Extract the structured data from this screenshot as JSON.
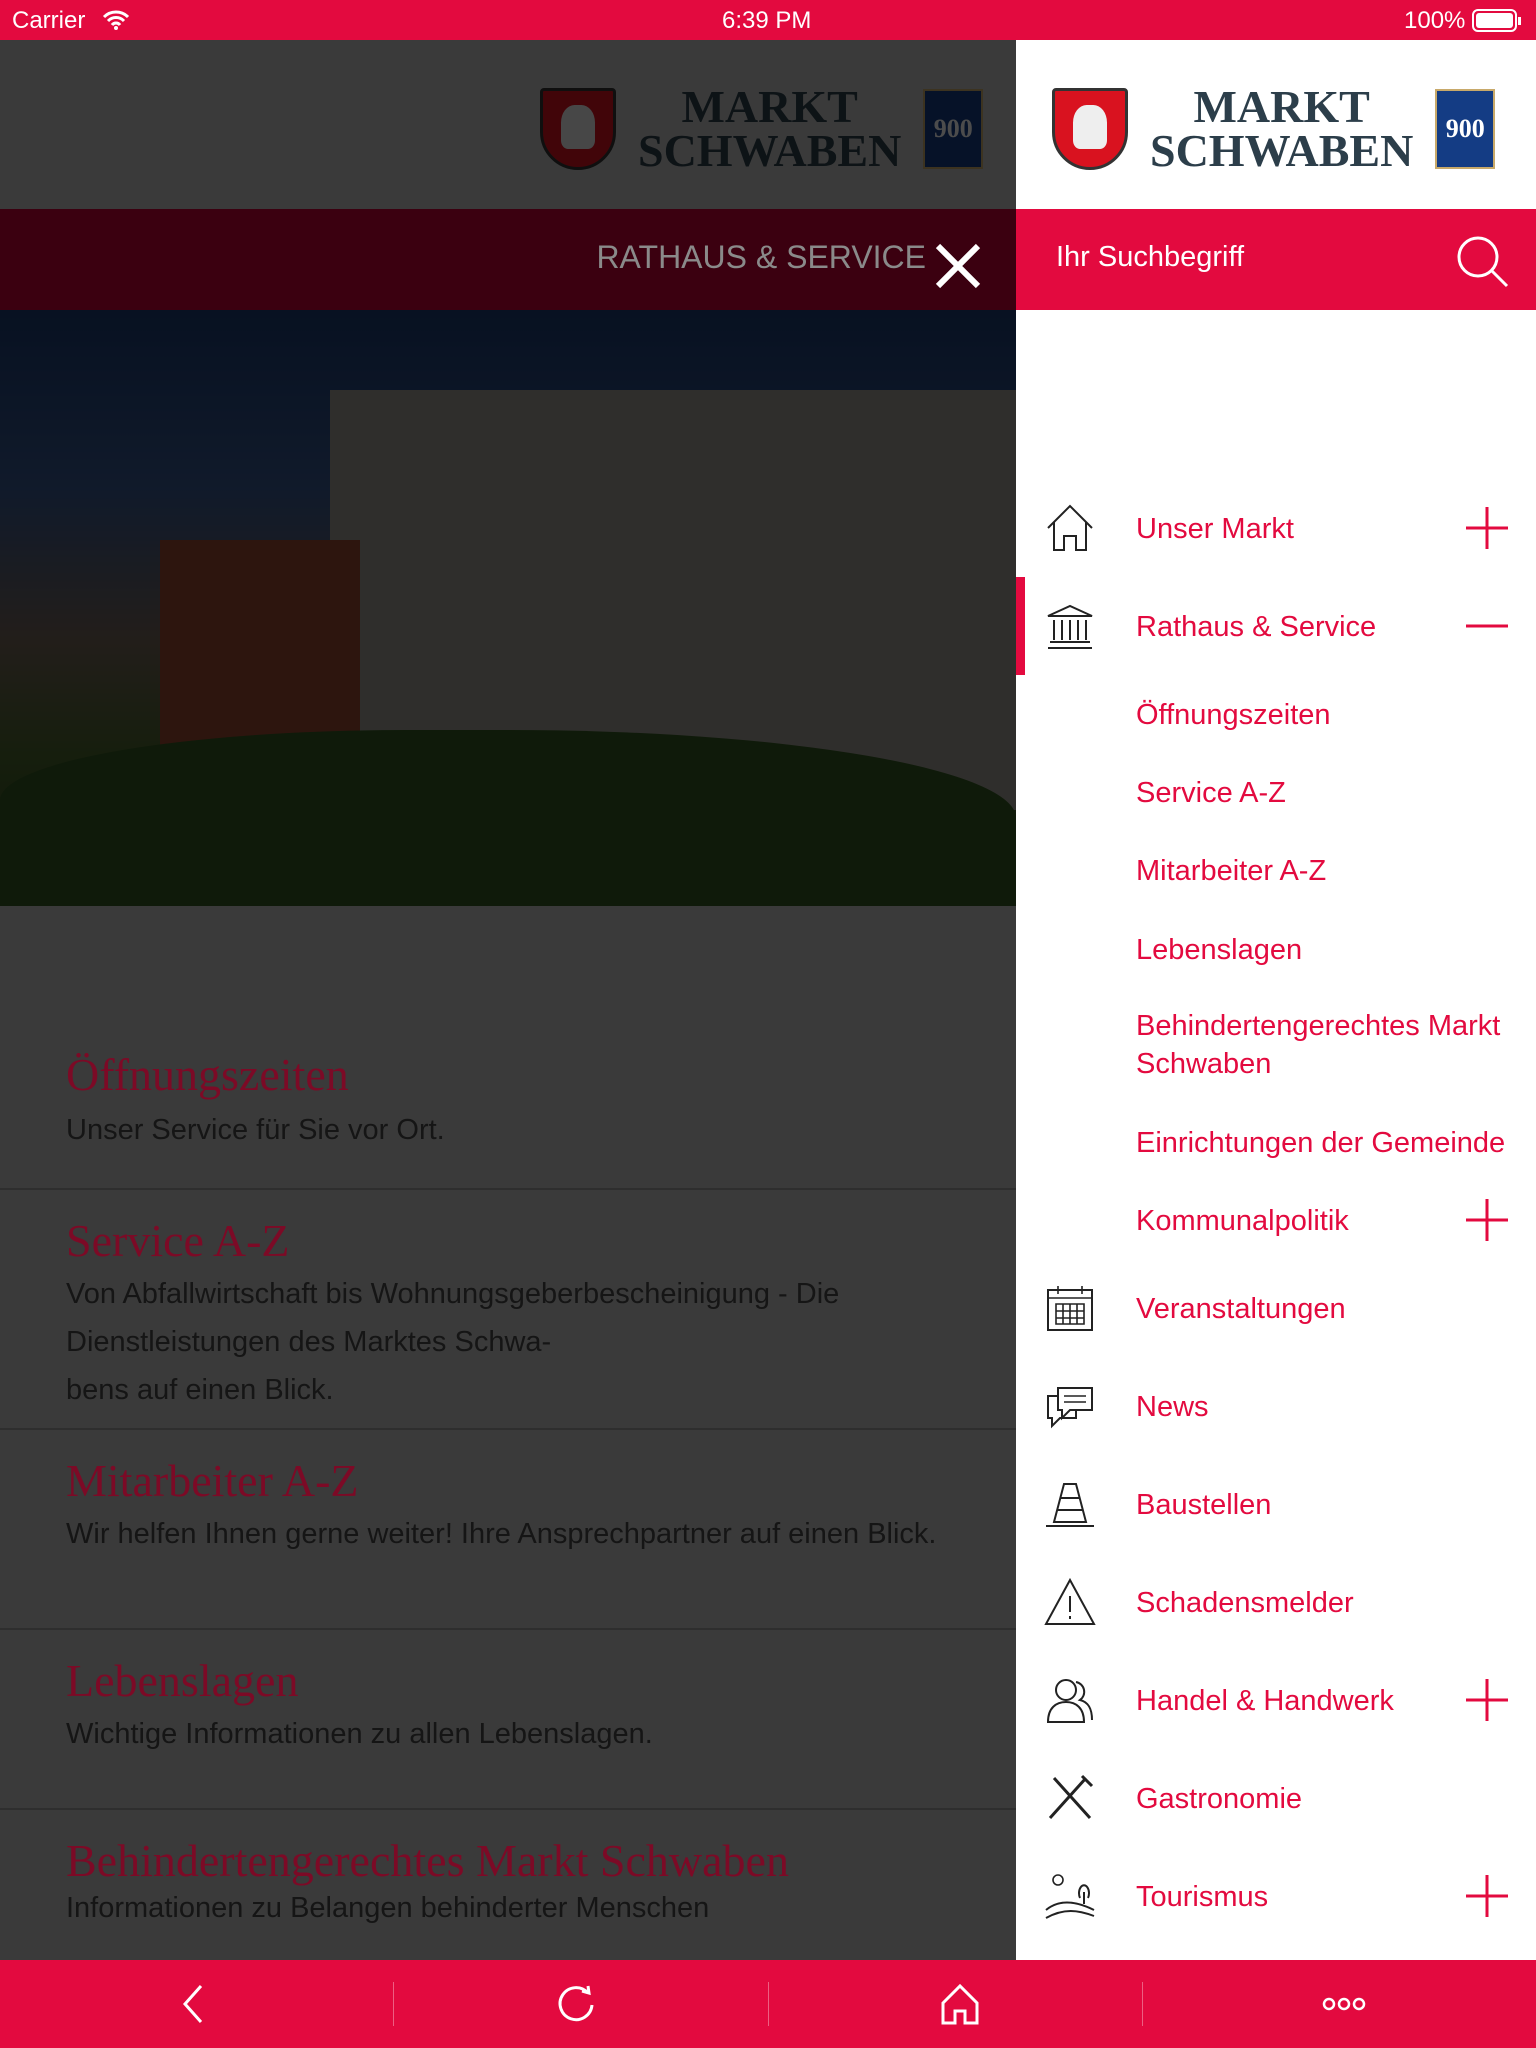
{
  "status_bar": {
    "carrier": "Carrier",
    "time": "6:39 PM",
    "battery": "100%"
  },
  "logo": {
    "line1": "MARKT",
    "line2": "SCHWABEN",
    "badge": "900"
  },
  "page": {
    "nav_title": "RATHAUS & SERVICE",
    "items": [
      {
        "title": "Öffnungszeiten",
        "text": "Unser Service für Sie vor Ort."
      },
      {
        "title": "Service A-Z",
        "text": "Von Abfallwirtschaft bis Wohnungsgeberbescheinigung - Die Dienstleistungen des Marktes Schwa-",
        "text2": "bens auf einen Blick."
      },
      {
        "title": "Mitarbeiter A-Z",
        "text": "Wir helfen Ihnen gerne weiter! Ihre Ansprechpartner auf einen Blick."
      },
      {
        "title": "Lebenslagen",
        "text": "Wichtige Informationen zu allen Lebenslagen."
      },
      {
        "title": "Behindertengerechtes Markt Schwaben",
        "text": "Informationen zu Belangen behinderter Menschen"
      }
    ]
  },
  "drawer": {
    "search_placeholder": "Ihr Suchbegriff",
    "menu": [
      {
        "label": "Unser Markt",
        "icon": "home-icon",
        "toggle": "plus"
      },
      {
        "label": "Rathaus & Service",
        "icon": "town-hall-icon",
        "toggle": "minus",
        "active": true
      },
      {
        "label": "Öffnungszeiten",
        "sub": true
      },
      {
        "label": "Service A-Z",
        "sub": true
      },
      {
        "label": "Mitarbeiter A-Z",
        "sub": true
      },
      {
        "label": "Lebenslagen",
        "sub": true
      },
      {
        "label": "Behindertengerechtes Markt Schwaben",
        "sub": true
      },
      {
        "label": "Einrichtungen der Gemeinde",
        "sub": true
      },
      {
        "label": "Kommunalpolitik",
        "sub": true,
        "toggle": "plus"
      },
      {
        "label": "Veranstaltungen",
        "icon": "calendar-icon"
      },
      {
        "label": "News",
        "icon": "chat-bubbles-icon"
      },
      {
        "label": "Baustellen",
        "icon": "traffic-cone-icon"
      },
      {
        "label": "Schadensmelder",
        "icon": "warning-icon"
      },
      {
        "label": "Handel & Handwerk",
        "icon": "people-icon",
        "toggle": "plus"
      },
      {
        "label": "Gastronomie",
        "icon": "fork-knife-icon"
      },
      {
        "label": "Tourismus",
        "icon": "landscape-icon",
        "toggle": "plus"
      }
    ]
  },
  "bottom_bar": [
    "back-icon",
    "reload-icon",
    "home-icon",
    "more-icon"
  ],
  "colors": {
    "accent": "#e30a3f",
    "logo_text": "#2c3e4a"
  }
}
